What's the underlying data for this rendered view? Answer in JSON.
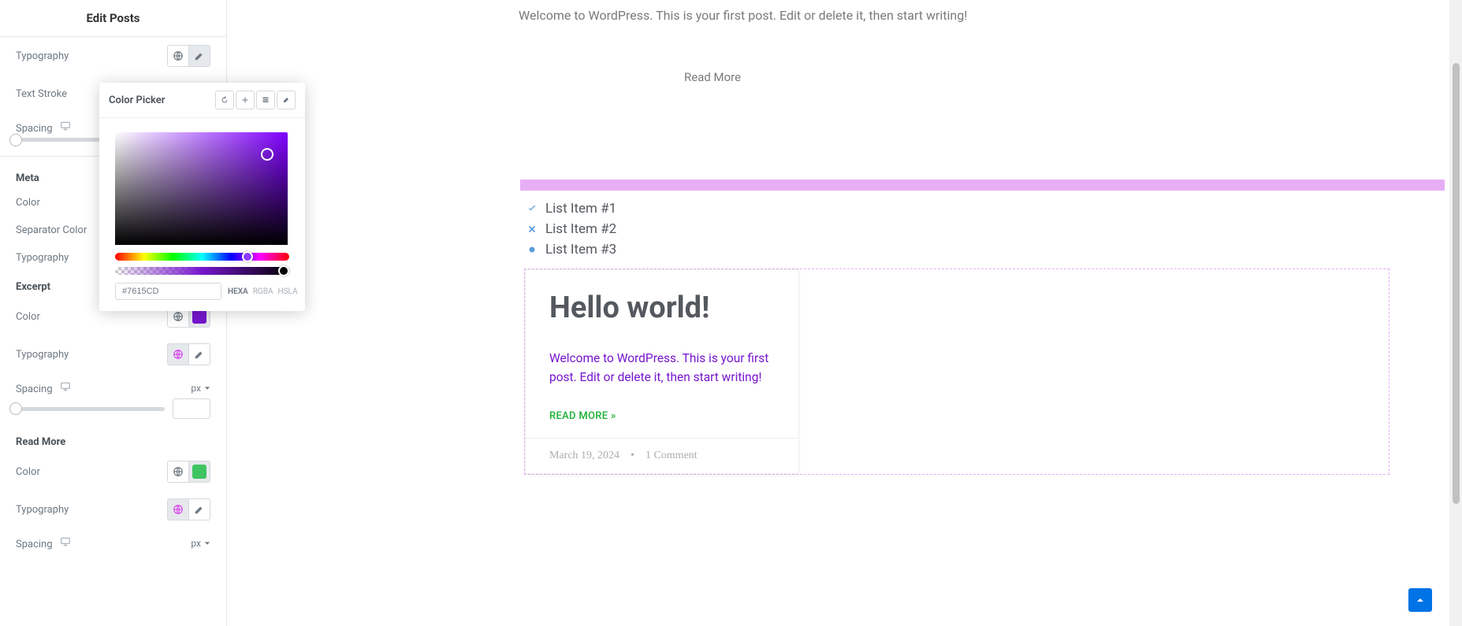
{
  "header": {
    "title": "Edit Posts"
  },
  "sidebar": {
    "controls": {
      "typography": "Typography",
      "text_stroke": "Text Stroke",
      "spacing": "Spacing",
      "color": "Color",
      "separator_color": "Separator Color"
    },
    "sections": {
      "meta": "Meta",
      "excerpt": "Excerpt",
      "read_more": "Read More"
    },
    "units": {
      "px": "px"
    }
  },
  "color_picker": {
    "title": "Color Picker",
    "hex": "#7615CD",
    "modes": [
      "HEXA",
      "RGBA",
      "HSLA"
    ],
    "active_mode": "HEXA"
  },
  "preview": {
    "welcome_text": "Welcome to WordPress. This is your first post. Edit or delete it, then start writing!",
    "read_more": "Read More",
    "list": [
      "List Item #1",
      "List Item #2",
      "List Item #3"
    ],
    "post": {
      "title": "Hello world!",
      "excerpt": "Welcome to WordPress. This is your first post. Edit or delete it, then start writing!",
      "read_more": "READ MORE »",
      "date": "March 19, 2024",
      "comments": "1 Comment"
    }
  },
  "colors": {
    "excerpt": "#7615CD",
    "read_more": "#1aaf32"
  }
}
